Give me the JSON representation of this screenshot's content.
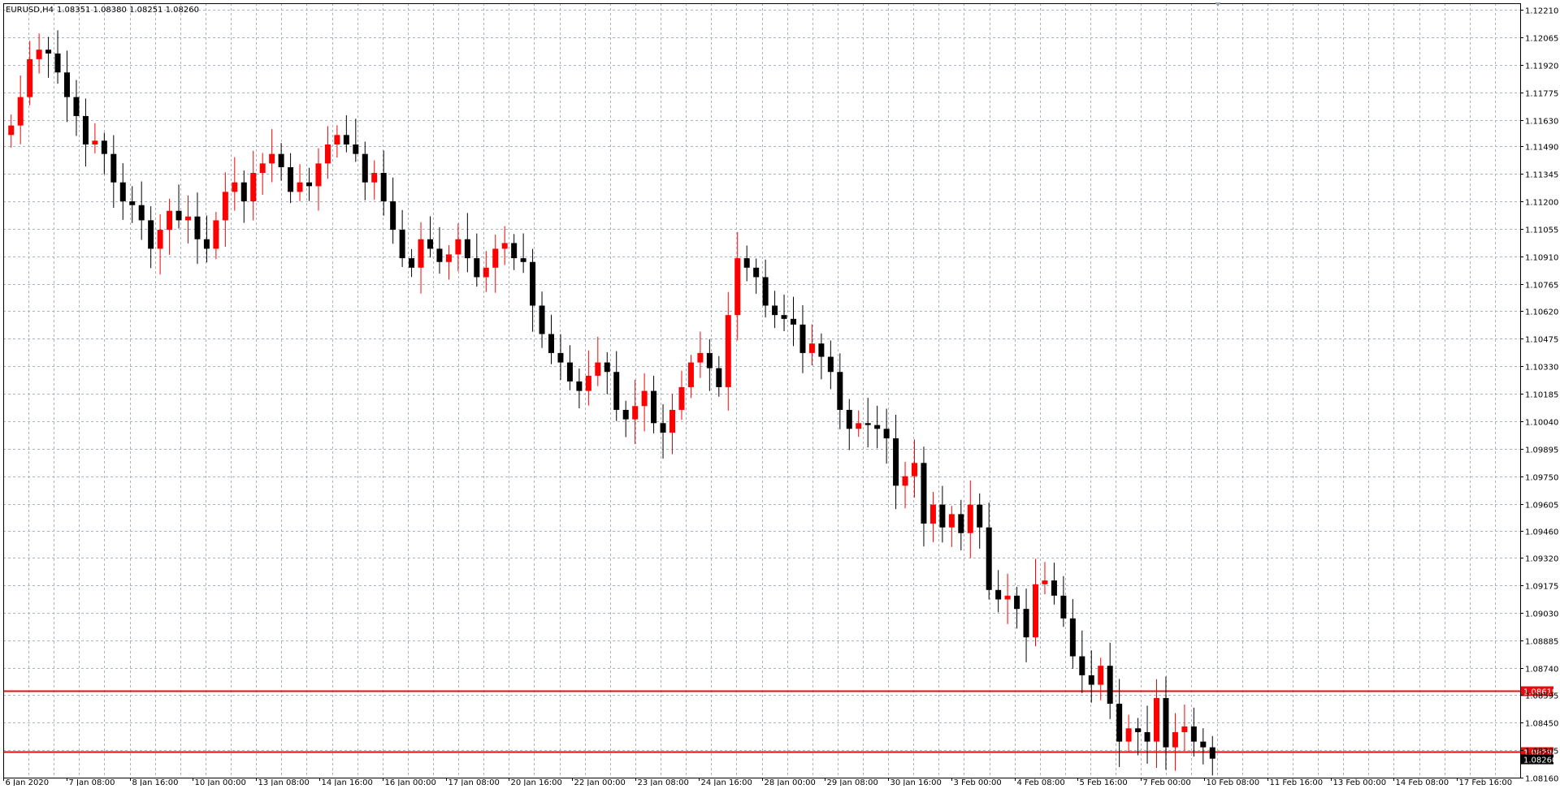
{
  "header": {
    "symbol_timeframe": "EURUSD,H4",
    "ohlc_text": "1.08351 1.08380 1.08251 1.08260"
  },
  "colors": {
    "background": "#ffffff",
    "grid": "#a8b4c0",
    "bull": "#ff0000",
    "bear": "#000000",
    "level_line": "#e01010",
    "axis_text": "#000000"
  },
  "chart_data": {
    "type": "candlestick",
    "title": "EURUSD,H4",
    "ylim": [
      1.0816,
      1.12245
    ],
    "grid": true,
    "y_tick_labels": [
      "1.12210",
      "1.12065",
      "1.11920",
      "1.11775",
      "1.11630",
      "1.11490",
      "1.11345",
      "1.11200",
      "1.11055",
      "1.10910",
      "1.10765",
      "1.10620",
      "1.10475",
      "1.10330",
      "1.10185",
      "1.10040",
      "1.09895",
      "1.09750",
      "1.09605",
      "1.09460",
      "1.09320",
      "1.09175",
      "1.09030",
      "1.08885",
      "1.08740",
      "1.08595",
      "1.08450",
      "1.08305",
      "1.08160"
    ],
    "x_tick_labels": [
      "6 Jan 2020",
      "7 Jan 08:00",
      "8 Jan 16:00",
      "10 Jan 00:00",
      "13 Jan 08:00",
      "14 Jan 16:00",
      "16 Jan 00:00",
      "17 Jan 08:00",
      "20 Jan 16:00",
      "22 Jan 00:00",
      "23 Jan 08:00",
      "24 Jan 16:00",
      "28 Jan 00:00",
      "29 Jan 08:00",
      "30 Jan 16:00",
      "3 Feb 00:00",
      "4 Feb 08:00",
      "5 Feb 16:00",
      "7 Feb 00:00",
      "10 Feb 08:00",
      "11 Feb 16:00",
      "13 Feb 00:00",
      "14 Feb 08:00",
      "17 Feb 16:00"
    ],
    "close_series": [
      1.116,
      1.1175,
      1.1195,
      1.12,
      1.1198,
      1.1188,
      1.1175,
      1.1165,
      1.115,
      1.1152,
      1.1145,
      1.113,
      1.112,
      1.1118,
      1.111,
      1.1095,
      1.1105,
      1.1115,
      1.111,
      1.1112,
      1.11,
      1.1095,
      1.111,
      1.1125,
      1.113,
      1.112,
      1.1135,
      1.114,
      1.1145,
      1.1138,
      1.1125,
      1.113,
      1.1128,
      1.114,
      1.115,
      1.1155,
      1.115,
      1.1145,
      1.113,
      1.1135,
      1.112,
      1.1105,
      1.109,
      1.1085,
      1.11,
      1.1095,
      1.1088,
      1.1092,
      1.11,
      1.109,
      1.108,
      1.1085,
      1.1095,
      1.1098,
      1.109,
      1.1088,
      1.1065,
      1.105,
      1.104,
      1.1035,
      1.1025,
      1.102,
      1.1028,
      1.1035,
      1.103,
      1.101,
      1.1005,
      1.1012,
      1.102,
      1.1003,
      1.0998,
      1.101,
      1.1022,
      1.1035,
      1.104,
      1.1032,
      1.1022,
      1.106,
      1.109,
      1.1085,
      1.108,
      1.1065,
      1.106,
      1.1058,
      1.1055,
      1.104,
      1.1045,
      1.1038,
      1.103,
      1.101,
      1.1,
      1.1003,
      1.1002,
      1.1,
      1.0995,
      1.097,
      1.0975,
      1.0982,
      1.095,
      1.096,
      1.0948,
      1.0955,
      1.0945,
      1.096,
      1.0948,
      1.0915,
      1.091,
      1.0912,
      1.0905,
      1.089,
      1.0918,
      1.092,
      1.0912,
      1.09,
      1.088,
      1.087,
      1.0865,
      1.0875,
      1.0855,
      1.0835,
      1.0842,
      1.084,
      1.0835,
      1.0858,
      1.0832,
      1.084,
      1.0843,
      1.0835,
      1.0832,
      1.0826
    ],
    "horizontal_levels": [
      {
        "price": 1.08619,
        "label": "1.08619"
      },
      {
        "price": 1.08296,
        "label": "1.08296"
      }
    ],
    "current_price_label": "1.08260"
  }
}
